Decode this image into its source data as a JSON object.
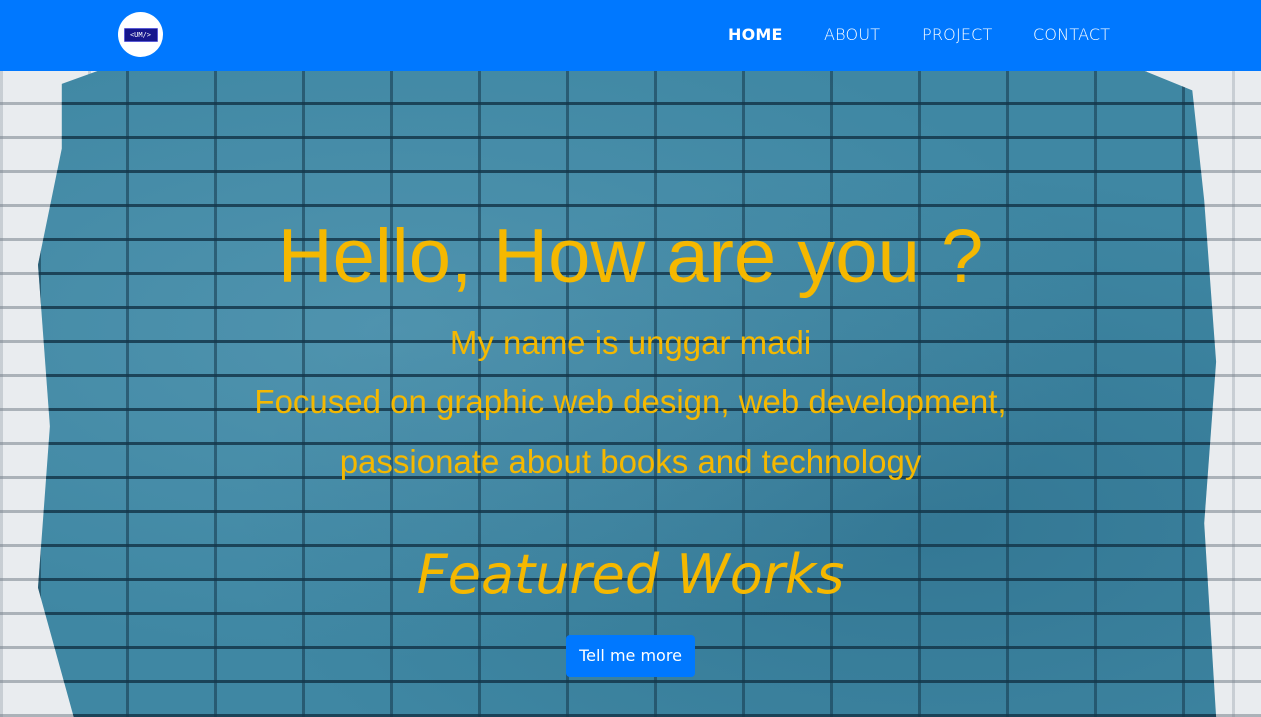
{
  "navbar": {
    "logo_text": "<UM/>",
    "links": [
      {
        "label": "HOME",
        "active": true
      },
      {
        "label": "ABOUT",
        "active": false
      },
      {
        "label": "PROJECT",
        "active": false
      },
      {
        "label": "CONTACT",
        "active": false
      }
    ]
  },
  "hero": {
    "title": "Hello, How are you ?",
    "lines": [
      "My name is unggar madi",
      "Focused on graphic web design, web development,",
      "passionate about books and technology"
    ],
    "featured_heading": "Featured Works",
    "cta_label": "Tell me more"
  },
  "colors": {
    "navbar_bg": "#0078ff",
    "accent_text": "#f5b800",
    "button_bg": "#0078ff",
    "wall_paint": "#3f87a3"
  }
}
